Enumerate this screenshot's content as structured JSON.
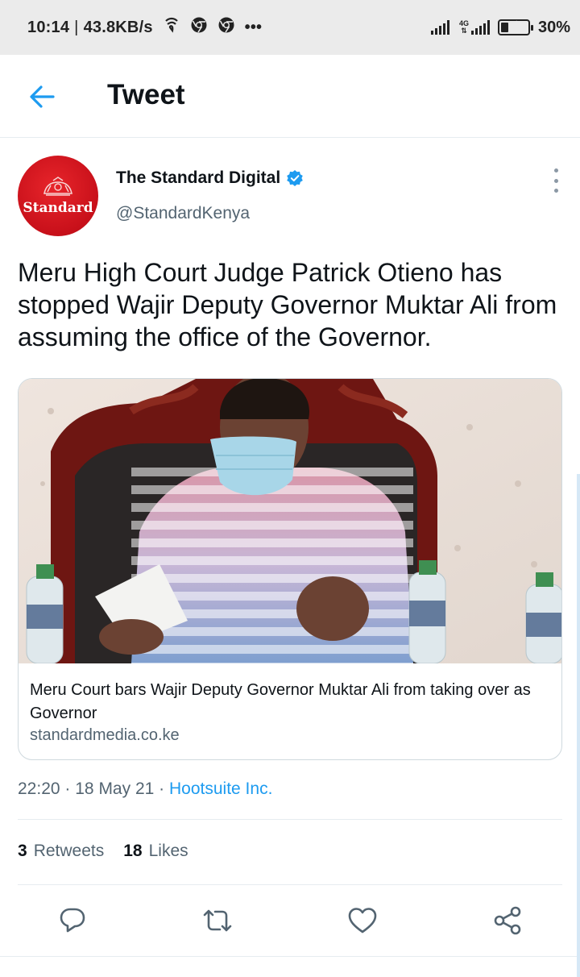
{
  "status_bar": {
    "time": "10:14",
    "speed": "43.8KB/s",
    "more": "•••",
    "network": "4G",
    "battery_level": 0.3,
    "battery_percent": "30%"
  },
  "header": {
    "title": "Tweet"
  },
  "tweet": {
    "avatar_text": "Standard",
    "display_name": "The Standard Digital",
    "handle": "@StandardKenya",
    "text": "Meru High Court Judge Patrick Otieno has stopped Wajir Deputy Governor Muktar Ali from assuming the office of the Governor.",
    "card": {
      "title": "Meru Court bars Wajir Deputy Governor Muktar Ali from taking over as Governor",
      "domain": "standardmedia.co.ke"
    },
    "time": "22:20",
    "date": "18 May 21",
    "source": "Hootsuite Inc.",
    "dot": "·",
    "retweets_count": "3",
    "retweets_label": "Retweets",
    "likes_count": "18",
    "likes_label": "Likes"
  },
  "colors": {
    "accent": "#1d9bf0",
    "text": "#0f1419",
    "muted": "#536471",
    "avatar_red": "#d0111b",
    "status_bar_bg": "#ebebeb"
  },
  "icons": {
    "back": "arrow-left-icon",
    "verified": "verified-badge-icon",
    "more": "more-vertical-icon",
    "reply": "comment-icon",
    "retweet": "retweet-icon",
    "like": "heart-icon",
    "share": "share-icon"
  }
}
